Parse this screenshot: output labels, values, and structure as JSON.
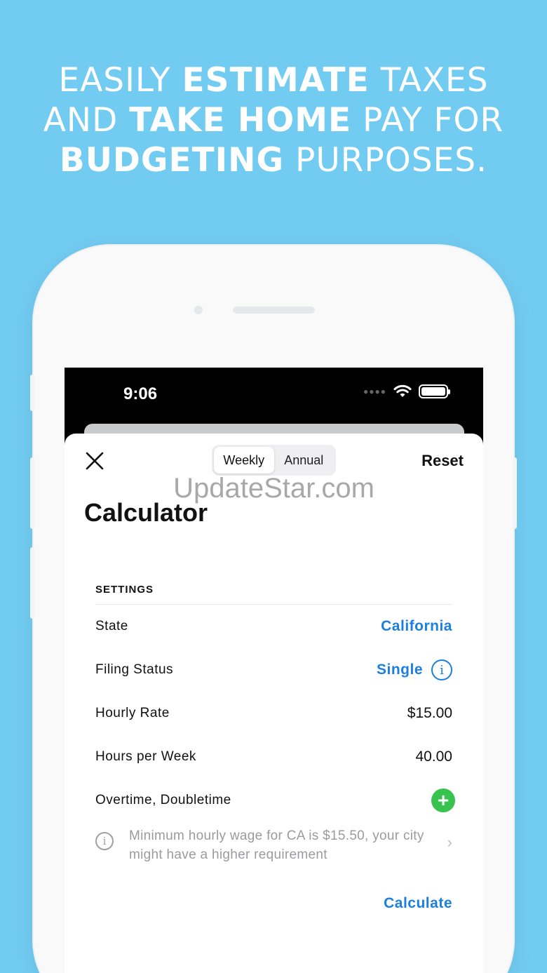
{
  "headline": {
    "line1": {
      "a": "EASILY ",
      "b": "ESTIMATE",
      "c": " TAXES"
    },
    "line2": {
      "a": "AND ",
      "b": "TAKE HOME",
      "c": " PAY FOR"
    },
    "line3": {
      "b": "BUDGETING",
      "c": " PURPOSES."
    }
  },
  "status_bar": {
    "time": "9:06",
    "signal_icon": "signal-dots-icon",
    "wifi_icon": "wifi-icon",
    "battery_icon": "battery-icon"
  },
  "watermark": "UpdateStar.com",
  "toolbar": {
    "close_icon": "close-icon",
    "segments": [
      {
        "label": "Weekly",
        "selected": true
      },
      {
        "label": "Annual",
        "selected": false
      }
    ],
    "reset_label": "Reset"
  },
  "title": "Calculator",
  "settings": {
    "header": "SETTINGS",
    "rows": [
      {
        "label": "State",
        "value": "California"
      },
      {
        "label": "Filing Status",
        "value": "Single"
      },
      {
        "label": "Hourly Rate",
        "value": "$15.00"
      },
      {
        "label": "Hours per Week",
        "value": "40.00"
      },
      {
        "label": "Overtime, Doubletime",
        "value": "+"
      }
    ],
    "notice": "Minimum hourly wage for CA is $15.50, your city might have a higher requirement"
  },
  "calculate_label": "Calculate",
  "colors": {
    "background": "#72cbf1",
    "accent": "#1a7fde",
    "add": "#38c24e"
  }
}
